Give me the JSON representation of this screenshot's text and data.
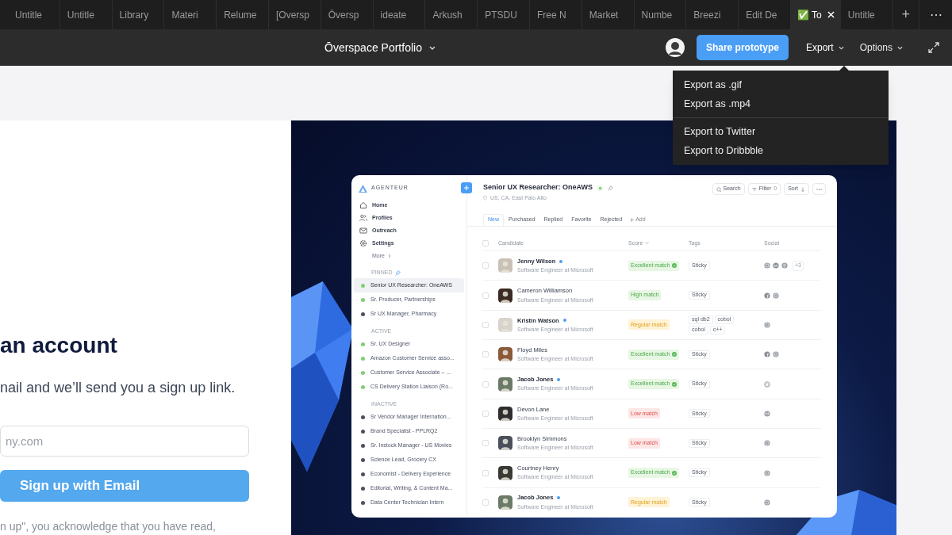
{
  "browser_tabs": [
    {
      "label": "Untitle",
      "selected": false
    },
    {
      "label": "Untitle",
      "selected": false
    },
    {
      "label": "Library",
      "selected": false
    },
    {
      "label": "Materi",
      "selected": false
    },
    {
      "label": "Relume",
      "selected": false
    },
    {
      "label": "[Oversp",
      "selected": false
    },
    {
      "label": "Översp",
      "selected": false
    },
    {
      "label": "ideate",
      "selected": false
    },
    {
      "label": "Arkush",
      "selected": false
    },
    {
      "label": "PTSDU",
      "selected": false
    },
    {
      "label": "Free N",
      "selected": false
    },
    {
      "label": "Market",
      "selected": false
    },
    {
      "label": "Numbe",
      "selected": false
    },
    {
      "label": "Breezi",
      "selected": false
    },
    {
      "label": "Edit De",
      "selected": false
    },
    {
      "label": "✅ To",
      "selected": true
    },
    {
      "label": "Untitle",
      "selected": false
    }
  ],
  "new_tab_button": "+",
  "more_button": "⋯",
  "toolbar": {
    "title": "Ōverspace Portfolio",
    "share_button": "Share prototype",
    "menus": [
      {
        "label": "Export",
        "open": true
      },
      {
        "label": "Options",
        "open": false
      }
    ]
  },
  "export_menu": {
    "groups": [
      [
        "Export as .gif",
        "Export as .mp4"
      ],
      [
        "Export to Twitter",
        "Export to Dribbble"
      ]
    ]
  },
  "signup": {
    "heading": "an account",
    "subtitle": "nail and we’ll send you a sign up link.",
    "email_placeholder": "ny.com",
    "button": "Sign up with Email",
    "legal": "n up\", you acknowledge that you have read,"
  },
  "app": {
    "brand": "AGENTEUR",
    "nav": [
      "Home",
      "Profiles",
      "Outreach",
      "Settings"
    ],
    "more": "More",
    "sections": [
      {
        "title": "PINNED",
        "pin_icon": true,
        "items": [
          {
            "label": "Senior UX Researcher: OneAWS",
            "color": "#7fcf73",
            "selected": true
          },
          {
            "label": "Sr. Producer, Partnerships",
            "color": "#7fcf73",
            "selected": false
          },
          {
            "label": "Sr UX Manager, Pharmacy",
            "color": "#4b5160",
            "selected": false
          }
        ]
      },
      {
        "title": "ACTIVE",
        "pin_icon": false,
        "items": [
          {
            "label": "Sr. UX Designer",
            "color": "#7fcf73",
            "selected": false
          },
          {
            "label": "Amazon Customer Service asso...",
            "color": "#7fcf73",
            "selected": false
          },
          {
            "label": "Customer Service Associate – ...",
            "color": "#7fcf73",
            "selected": false
          },
          {
            "label": "CS Delivery Station Liaison (Ro...",
            "color": "#7fcf73",
            "selected": false
          }
        ]
      },
      {
        "title": "INACTIVE",
        "pin_icon": false,
        "items": [
          {
            "label": "Sr Vendor Manager Internation...",
            "color": "#4b5160",
            "selected": false
          },
          {
            "label": "Brand Specialist - PPLRQ2",
            "color": "#4b5160",
            "selected": false
          },
          {
            "label": "Sr. Instock Manager - US Movies",
            "color": "#4b5160",
            "selected": false
          },
          {
            "label": "Science Lead, Grocery CX",
            "color": "#4b5160",
            "selected": false
          },
          {
            "label": "Economist - Delivery Experience",
            "color": "#4b5160",
            "selected": false
          },
          {
            "label": "Editorial, Writing, & Content Ma...",
            "color": "#4b5160",
            "selected": false
          },
          {
            "label": "Data Center Technician Intern",
            "color": "#4b5160",
            "selected": false
          }
        ]
      }
    ],
    "job": {
      "title": "Senior UX Researcher: OneAWS",
      "location": "US, CA, East Palo Alto"
    },
    "actions": [
      {
        "kind": "search",
        "label": "Search"
      },
      {
        "kind": "filter",
        "label": "Filter",
        "count": "0"
      },
      {
        "kind": "sort",
        "label": "Sort"
      },
      {
        "kind": "more"
      }
    ],
    "tabs": [
      {
        "label": "New",
        "selected": true
      },
      {
        "label": "Purchased",
        "selected": false
      },
      {
        "label": "Replied",
        "selected": false
      },
      {
        "label": "Favorite",
        "selected": false
      },
      {
        "label": "Rejected",
        "selected": false
      }
    ],
    "add_tab": "Add",
    "select_all_checked": false,
    "columns": [
      {
        "label": "Candidate",
        "sortable": false
      },
      {
        "label": "Score",
        "sortable": true
      },
      {
        "label": "Tags",
        "sortable": false
      },
      {
        "label": "Social",
        "sortable": false
      }
    ],
    "rows": [
      {
        "checked": false,
        "name": "Jenny Wilson",
        "unread": true,
        "role": "Software Engineer at Microsoft",
        "score": {
          "label": "Excellent match",
          "kind": "excellent"
        },
        "tags": [
          "Sticky"
        ],
        "social": [
          {
            "kind": "dribbble"
          },
          {
            "kind": "linkedin"
          },
          {
            "kind": "pinterest"
          }
        ],
        "social_more": "+3"
      },
      {
        "checked": false,
        "name": "Cameron Williamson",
        "unread": false,
        "role": "Software Engineer at Microsoft",
        "score": {
          "label": "High match",
          "kind": "high"
        },
        "tags": [
          "Sticky"
        ],
        "social": [
          {
            "kind": "facebook"
          },
          {
            "kind": "dribbble"
          }
        ]
      },
      {
        "checked": false,
        "name": "Kristin Watson",
        "unread": true,
        "role": "Software Engineer at Microsoft",
        "score": {
          "label": "Regular match",
          "kind": "regular"
        },
        "tags": [
          "sql db2",
          "cobol",
          "cobol",
          "c++"
        ],
        "social": [
          {
            "kind": "dribbble"
          }
        ]
      },
      {
        "checked": false,
        "name": "Floyd Miles",
        "unread": false,
        "role": "Software Engineer at Microsoft",
        "score": {
          "label": "Excellent match",
          "kind": "excellent"
        },
        "tags": [
          "Sticky"
        ],
        "social": [
          {
            "kind": "facebook"
          },
          {
            "kind": "dribbble"
          }
        ]
      },
      {
        "checked": false,
        "name": "Jacob Jones",
        "unread": true,
        "role": "Software Engineer at Microsoft",
        "score": {
          "label": "Excellent match",
          "kind": "excellent"
        },
        "tags": [
          "Sticky"
        ],
        "social": [
          {
            "kind": "github"
          }
        ]
      },
      {
        "checked": false,
        "name": "Devon Lane",
        "unread": false,
        "role": "Software Engineer at Microsoft",
        "score": {
          "label": "Low match",
          "kind": "low"
        },
        "tags": [
          "Sticky"
        ],
        "social": [
          {
            "kind": "medium"
          }
        ]
      },
      {
        "checked": false,
        "name": "Brooklyn Simmons",
        "unread": false,
        "role": "Software Engineer at Microsoft",
        "score": {
          "label": "Low match",
          "kind": "low"
        },
        "tags": [
          "Sticky"
        ],
        "social": [
          {
            "kind": "dribbble"
          }
        ]
      },
      {
        "checked": false,
        "name": "Courtney Henry",
        "unread": false,
        "role": "Software Engineer at Microsoft",
        "score": {
          "label": "Excellent match",
          "kind": "excellent"
        },
        "tags": [
          "Sticky"
        ],
        "social": [
          {
            "kind": "dribbble"
          }
        ]
      },
      {
        "checked": false,
        "name": "Jacob Jones",
        "unread": true,
        "role": "Software Engineer at Microsoft",
        "score": {
          "label": "Regular match",
          "kind": "regular"
        },
        "tags": [
          "Sticky"
        ],
        "social": [
          {
            "kind": "dribbble"
          }
        ]
      }
    ]
  }
}
